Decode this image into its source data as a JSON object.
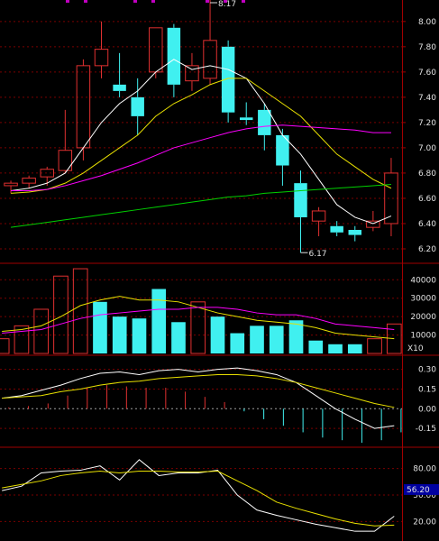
{
  "chart_data": [
    {
      "type": "candlestick",
      "ylim": [
        6.1,
        8.17
      ],
      "y_ticks": [
        "8.00",
        "7.80",
        "7.60",
        "7.40",
        "7.20",
        "7.00",
        "6.80",
        "6.60",
        "6.40",
        "6.20"
      ],
      "annotations": {
        "high": "8.17",
        "low": "6.17"
      },
      "candles": [
        {
          "o": 6.7,
          "h": 6.74,
          "l": 6.64,
          "c": 6.72
        },
        {
          "o": 6.72,
          "h": 6.78,
          "l": 6.68,
          "c": 6.76
        },
        {
          "o": 6.77,
          "h": 6.85,
          "l": 6.7,
          "c": 6.83
        },
        {
          "o": 6.82,
          "h": 7.3,
          "l": 6.8,
          "c": 6.98
        },
        {
          "o": 7.0,
          "h": 7.7,
          "l": 6.9,
          "c": 7.65
        },
        {
          "o": 7.65,
          "h": 8.0,
          "l": 7.55,
          "c": 7.78
        },
        {
          "o": 7.5,
          "h": 7.75,
          "l": 7.4,
          "c": 7.45
        },
        {
          "o": 7.4,
          "h": 7.55,
          "l": 7.1,
          "c": 7.25
        },
        {
          "o": 7.6,
          "h": 7.95,
          "l": 7.55,
          "c": 7.95
        },
        {
          "o": 7.95,
          "h": 7.98,
          "l": 7.4,
          "c": 7.5
        },
        {
          "o": 7.53,
          "h": 7.75,
          "l": 7.45,
          "c": 7.65
        },
        {
          "o": 7.55,
          "h": 8.17,
          "l": 7.5,
          "c": 7.85
        },
        {
          "o": 7.8,
          "h": 7.85,
          "l": 7.2,
          "c": 7.28
        },
        {
          "o": 7.24,
          "h": 7.36,
          "l": 7.18,
          "c": 7.22
        },
        {
          "o": 7.3,
          "h": 7.35,
          "l": 6.98,
          "c": 7.1
        },
        {
          "o": 7.1,
          "h": 7.15,
          "l": 6.7,
          "c": 6.86
        },
        {
          "o": 6.72,
          "h": 6.82,
          "l": 6.17,
          "c": 6.45
        },
        {
          "o": 6.42,
          "h": 6.53,
          "l": 6.3,
          "c": 6.5
        },
        {
          "o": 6.38,
          "h": 6.42,
          "l": 6.3,
          "c": 6.33
        },
        {
          "o": 6.35,
          "h": 6.38,
          "l": 6.26,
          "c": 6.31
        },
        {
          "o": 6.37,
          "h": 6.5,
          "l": 6.34,
          "c": 6.42
        },
        {
          "o": 6.4,
          "h": 6.92,
          "l": 6.3,
          "c": 6.8
        }
      ],
      "series": [
        {
          "color": "#ffffff",
          "values": [
            6.66,
            6.68,
            6.72,
            6.8,
            7.0,
            7.2,
            7.35,
            7.45,
            7.6,
            7.7,
            7.62,
            7.65,
            7.62,
            7.55,
            7.35,
            7.1,
            6.95,
            6.75,
            6.55,
            6.45,
            6.4,
            6.46
          ]
        },
        {
          "color": "#e8e000",
          "values": [
            6.64,
            6.65,
            6.67,
            6.72,
            6.8,
            6.9,
            7.0,
            7.1,
            7.25,
            7.35,
            7.42,
            7.5,
            7.55,
            7.55,
            7.45,
            7.35,
            7.25,
            7.1,
            6.95,
            6.85,
            6.75,
            6.68
          ]
        },
        {
          "color": "#ff00ff",
          "values": [
            6.66,
            6.66,
            6.67,
            6.7,
            6.74,
            6.78,
            6.83,
            6.88,
            6.94,
            7.0,
            7.04,
            7.08,
            7.12,
            7.15,
            7.17,
            7.18,
            7.17,
            7.16,
            7.15,
            7.14,
            7.12,
            7.12
          ]
        },
        {
          "color": "#00d000",
          "values": [
            6.37,
            6.39,
            6.41,
            6.43,
            6.45,
            6.47,
            6.49,
            6.51,
            6.53,
            6.55,
            6.57,
            6.59,
            6.61,
            6.62,
            6.64,
            6.65,
            6.66,
            6.67,
            6.68,
            6.69,
            6.7,
            6.71
          ]
        }
      ]
    },
    {
      "type": "bar",
      "ylim": [
        0,
        47000
      ],
      "y_ticks": [
        "40000",
        "30000",
        "20000",
        "10000"
      ],
      "unit_label": "X10",
      "values": [
        8000,
        15000,
        24000,
        42000,
        46000,
        28000,
        20000,
        19000,
        35000,
        17000,
        28000,
        20000,
        11000,
        15000,
        15000,
        18000,
        7000,
        5000,
        5000,
        8000,
        16000
      ],
      "up": [
        true,
        true,
        true,
        true,
        true,
        false,
        false,
        false,
        false,
        false,
        true,
        false,
        false,
        false,
        false,
        false,
        false,
        false,
        false,
        true,
        true
      ],
      "series": [
        {
          "color": "#e8e000",
          "values": [
            12000,
            13000,
            15000,
            20000,
            26000,
            29000,
            31000,
            29000,
            29000,
            28000,
            25000,
            22000,
            20000,
            18000,
            17000,
            16000,
            14000,
            11000,
            10000,
            9000,
            8000
          ]
        },
        {
          "color": "#ff00ff",
          "values": [
            11000,
            12000,
            13000,
            16000,
            19000,
            21000,
            22000,
            23000,
            24000,
            24000,
            25000,
            25000,
            24000,
            22000,
            21000,
            21000,
            19000,
            16000,
            15000,
            14000,
            13000
          ]
        }
      ]
    },
    {
      "type": "bar",
      "ylim": [
        -0.28,
        0.38
      ],
      "y_ticks": [
        "0.30",
        "0.15",
        "0.00",
        "-0.15"
      ],
      "values": [
        0.01,
        0.02,
        0.04,
        0.1,
        0.16,
        0.18,
        0.17,
        0.16,
        0.16,
        0.13,
        0.09,
        0.05,
        -0.02,
        -0.08,
        -0.13,
        -0.18,
        -0.22,
        -0.24,
        -0.26,
        -0.24,
        -0.18
      ],
      "series": [
        {
          "color": "#ffffff",
          "values": [
            0.08,
            0.1,
            0.14,
            0.18,
            0.23,
            0.27,
            0.28,
            0.26,
            0.29,
            0.3,
            0.28,
            0.3,
            0.31,
            0.29,
            0.26,
            0.2,
            0.1,
            0.0,
            -0.08,
            -0.15,
            -0.13
          ]
        },
        {
          "color": "#e8e000",
          "values": [
            0.08,
            0.09,
            0.1,
            0.13,
            0.15,
            0.18,
            0.2,
            0.21,
            0.23,
            0.24,
            0.25,
            0.26,
            0.26,
            0.25,
            0.23,
            0.2,
            0.16,
            0.12,
            0.08,
            0.04,
            0.01
          ]
        }
      ]
    },
    {
      "type": "line",
      "ylim": [
        0,
        100
      ],
      "y_ticks": [
        "80.00",
        "50.00",
        "20.00"
      ],
      "marker_value": "56.20",
      "series": [
        {
          "color": "#ffffff",
          "values": [
            55,
            60,
            75,
            77,
            78,
            83,
            67,
            90,
            72,
            75,
            75,
            78,
            50,
            33,
            27,
            22,
            17,
            13,
            9,
            9,
            26
          ]
        },
        {
          "color": "#e8e000",
          "values": [
            58,
            62,
            66,
            72,
            75,
            77,
            75,
            77,
            77,
            76,
            76,
            77,
            66,
            55,
            42,
            35,
            29,
            23,
            18,
            15,
            16
          ]
        }
      ]
    }
  ]
}
